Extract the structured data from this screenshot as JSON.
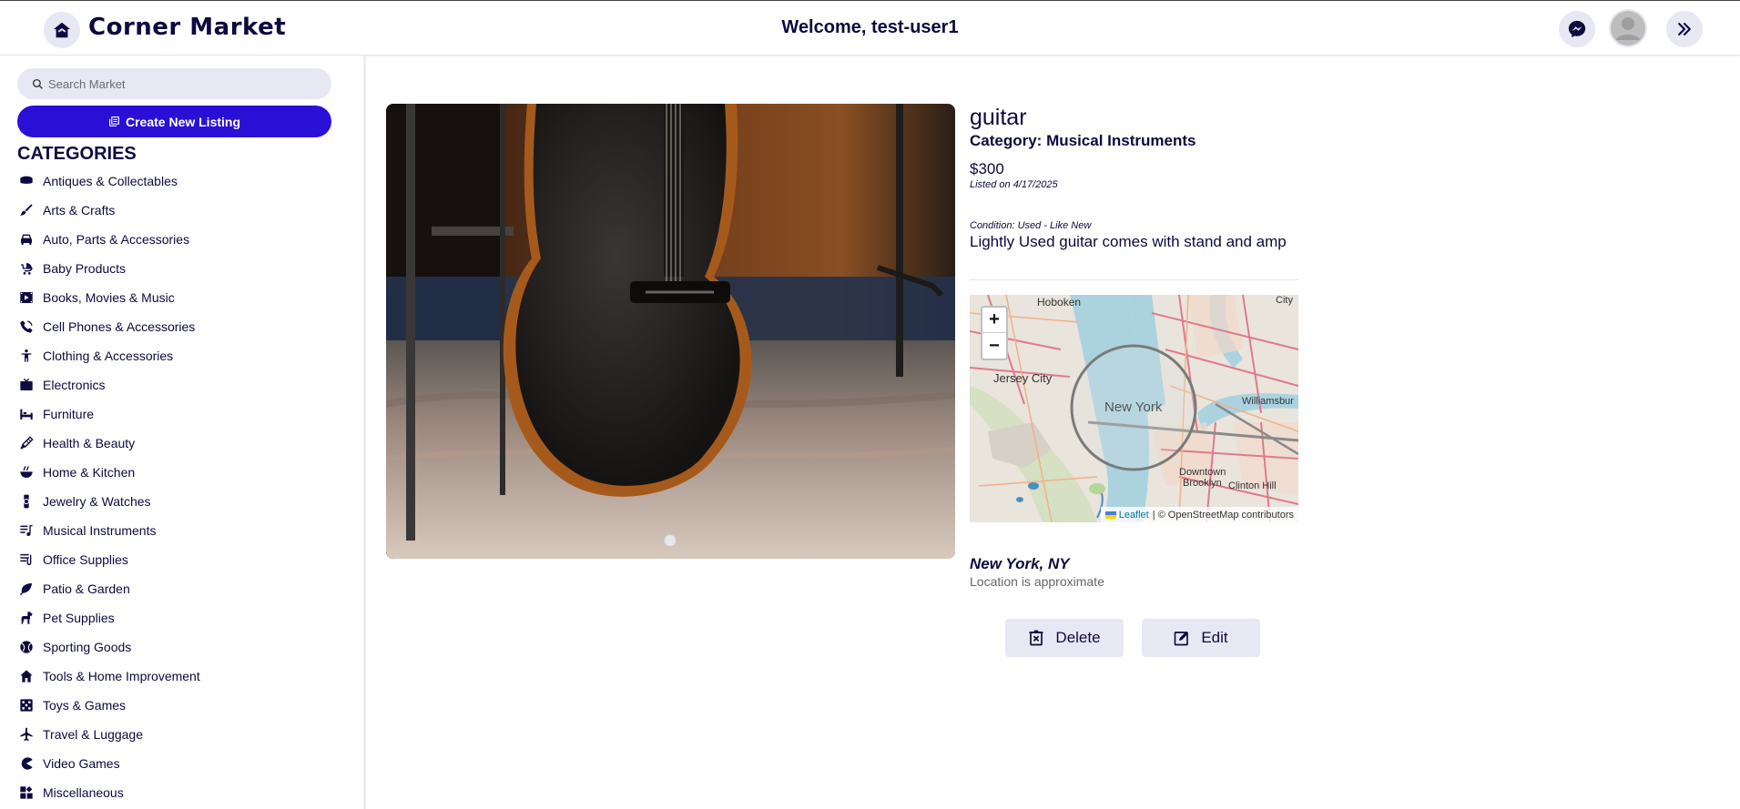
{
  "app": {
    "name": "Corner Market",
    "welcome": "Welcome, test-user1"
  },
  "header": {
    "icons": [
      "home-icon",
      "messenger-icon",
      "avatar",
      "double-chevron-right-icon"
    ]
  },
  "sidebar": {
    "search_placeholder": "Search Market",
    "create_label": "Create New Listing",
    "categories_title": "CATEGORIES",
    "categories": [
      {
        "label": "Antiques & Collectables",
        "icon": "antiques-icon"
      },
      {
        "label": "Arts & Crafts",
        "icon": "brush-icon"
      },
      {
        "label": "Auto, Parts & Accessories",
        "icon": "car-icon"
      },
      {
        "label": "Baby Products",
        "icon": "stroller-icon"
      },
      {
        "label": "Books, Movies & Music",
        "icon": "film-icon"
      },
      {
        "label": "Cell Phones & Accessories",
        "icon": "phone-icon"
      },
      {
        "label": "Clothing & Accessories",
        "icon": "person-icon"
      },
      {
        "label": "Electronics",
        "icon": "tv-icon"
      },
      {
        "label": "Furniture",
        "icon": "bed-icon"
      },
      {
        "label": "Health & Beauty",
        "icon": "brush-beauty-icon"
      },
      {
        "label": "Home & Kitchen",
        "icon": "bowl-icon"
      },
      {
        "label": "Jewelry & Watches",
        "icon": "watch-icon"
      },
      {
        "label": "Musical Instruments",
        "icon": "music-list-icon"
      },
      {
        "label": "Office Supplies",
        "icon": "paperclip-icon"
      },
      {
        "label": "Patio & Garden",
        "icon": "leaf-icon"
      },
      {
        "label": "Pet Supplies",
        "icon": "dog-icon"
      },
      {
        "label": "Sporting Goods",
        "icon": "ball-icon"
      },
      {
        "label": "Tools & Home Improvement",
        "icon": "house-icon"
      },
      {
        "label": "Toys & Games",
        "icon": "dice-icon"
      },
      {
        "label": "Travel & Luggage",
        "icon": "plane-icon"
      },
      {
        "label": "Video Games",
        "icon": "pacman-icon"
      },
      {
        "label": "Miscellaneous",
        "icon": "widgets-icon"
      }
    ]
  },
  "listing": {
    "title": "guitar",
    "category": "Category: Musical Instruments",
    "price": "$300",
    "listed": "Listed on 4/17/2025",
    "condition": "Condition: Used - Like New",
    "description": "Lightly Used guitar comes with stand and amp",
    "location": "New York, NY",
    "location_note": "Location is approximate",
    "delete_label": "Delete",
    "edit_label": "Edit"
  },
  "map": {
    "zoom_in": "+",
    "zoom_out": "−",
    "attribution_leaflet": "Leaflet",
    "attribution_rest": "| © OpenStreetMap contributors",
    "labels": {
      "hoboken": "Hoboken",
      "jersey_city": "Jersey City",
      "new_york": "New York",
      "williamsburg": "Williamsbur",
      "downtown_brooklyn_1": "Downtown",
      "downtown_brooklyn_2": "Brooklyn",
      "clinton_hill": "Clinton Hill",
      "city": "City"
    }
  },
  "colors": {
    "primary": "#2a0fd6",
    "text": "#0c0a3e",
    "chip": "#e8e8f4"
  }
}
